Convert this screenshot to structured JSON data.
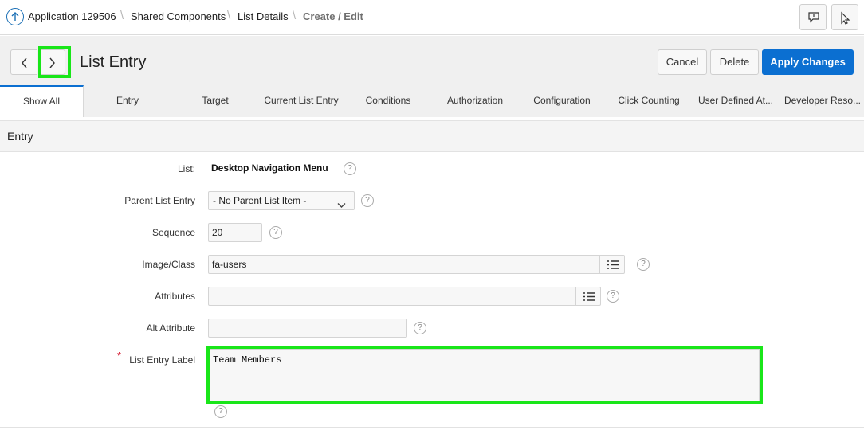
{
  "breadcrumb": {
    "app": "Application 129506",
    "shared": "Shared Components",
    "list_details": "List Details",
    "current": "Create / Edit",
    "separator": "\\"
  },
  "header": {
    "title": "List Entry",
    "cancel": "Cancel",
    "delete": "Delete",
    "apply": "Apply Changes"
  },
  "tabs": [
    {
      "label": "Show All",
      "active": true
    },
    {
      "label": "Entry"
    },
    {
      "label": "Target"
    },
    {
      "label": "Current List Entry"
    },
    {
      "label": "Conditions"
    },
    {
      "label": "Authorization"
    },
    {
      "label": "Configuration"
    },
    {
      "label": "Click Counting"
    },
    {
      "label": "User Defined At..."
    },
    {
      "label": "Developer Reso..."
    }
  ],
  "region": {
    "title": "Entry"
  },
  "form": {
    "list_label": "List:",
    "list_value": "Desktop Navigation Menu",
    "parent_label": "Parent List Entry",
    "parent_value": "- No Parent List Item -",
    "sequence_label": "Sequence",
    "sequence_value": "20",
    "image_label": "Image/Class",
    "image_value": "fa-users",
    "attributes_label": "Attributes",
    "attributes_value": "",
    "alt_label": "Alt Attribute",
    "alt_value": "",
    "entry_label_label": "List Entry Label",
    "entry_label_value": "Team Members",
    "required_mark": "*",
    "help_glyph": "?"
  },
  "colors": {
    "accent": "#0b6fd1",
    "highlight": "#19e619",
    "required": "#d0021b"
  },
  "icons": {
    "app": "arrow-up-circle-icon",
    "feedback": "speech-bubble-icon",
    "quick_edit": "pointer-icon",
    "prev": "chevron-left-icon",
    "next": "chevron-right-icon",
    "list_picker": "list-icon",
    "dropdown": "chevron-down-icon",
    "help": "help-icon"
  }
}
